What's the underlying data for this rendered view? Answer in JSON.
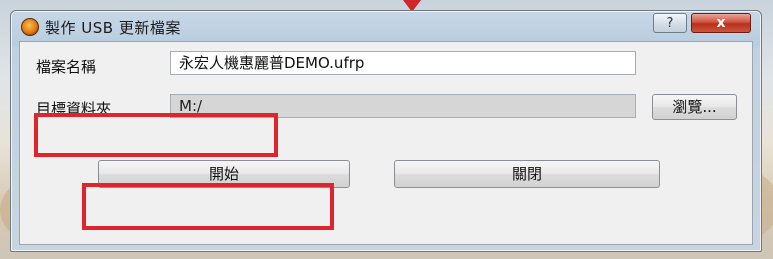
{
  "dialog": {
    "title": "製作 USB 更新檔案",
    "help_glyph": "?",
    "close_glyph": "x"
  },
  "form": {
    "filename_label": "檔案名稱",
    "filename_value": "永宏人機惠麗普DEMO.ufrp",
    "folder_label": "目標資料夾",
    "folder_value": "M:/",
    "browse_label": "瀏覽..."
  },
  "actions": {
    "start_label": "開始",
    "close_label": "關閉"
  },
  "colors": {
    "highlight": "#e0242b",
    "close_button": "#c9442e"
  }
}
